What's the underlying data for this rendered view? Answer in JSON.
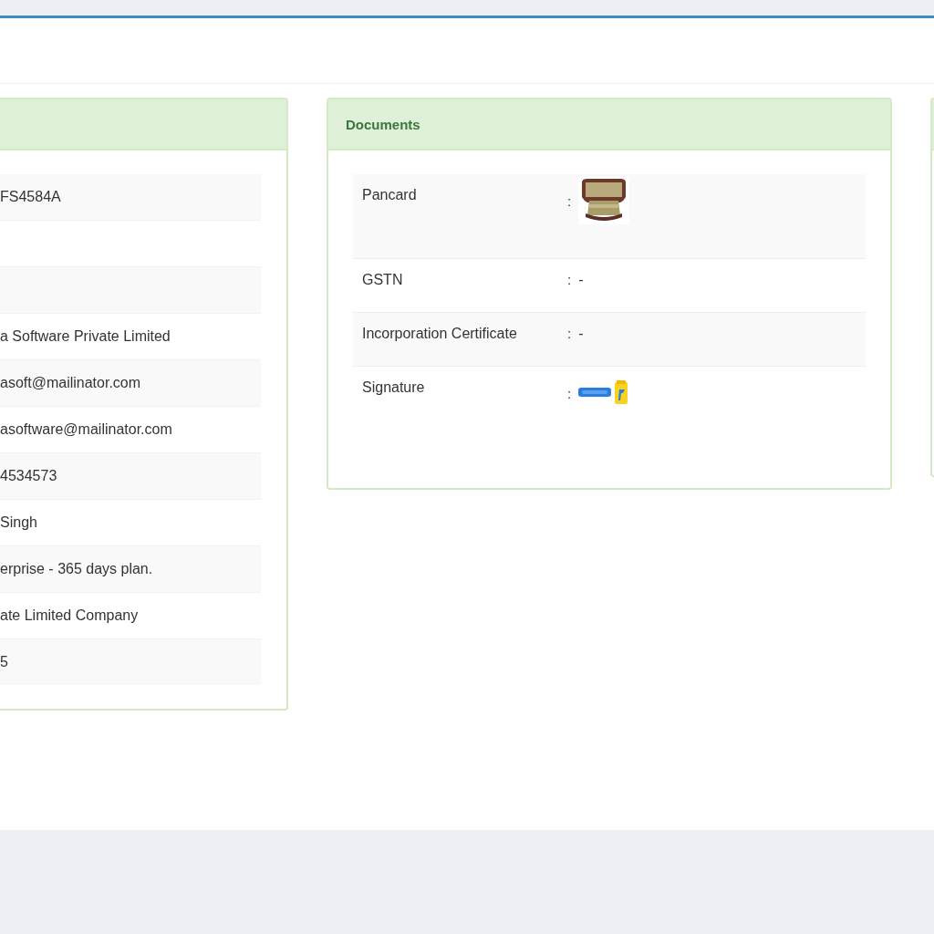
{
  "details_panel": {
    "rows": [
      {
        "value": "FS4584A"
      },
      {},
      {},
      {
        "value": "a Software Private Limited"
      },
      {
        "value": "asoft@mailinator.com"
      },
      {
        "value": "asoftware@mailinator.com"
      },
      {
        "value": "4534573"
      },
      {
        "value": "Singh"
      },
      {
        "value": "erprise - 365 days plan."
      },
      {
        "value": "ate Limited Company"
      },
      {
        "value": "5"
      }
    ]
  },
  "documents_panel": {
    "title": "Documents",
    "rows": [
      {
        "label": "Pancard",
        "separator": ":",
        "kind": "picture"
      },
      {
        "label": "GSTN",
        "separator": ":",
        "kind": "text",
        "value": "-"
      },
      {
        "label": "Incorporation Certificate",
        "separator": ":",
        "kind": "text",
        "value": "-"
      },
      {
        "label": "Signature",
        "separator": ":",
        "kind": "picture"
      }
    ]
  }
}
